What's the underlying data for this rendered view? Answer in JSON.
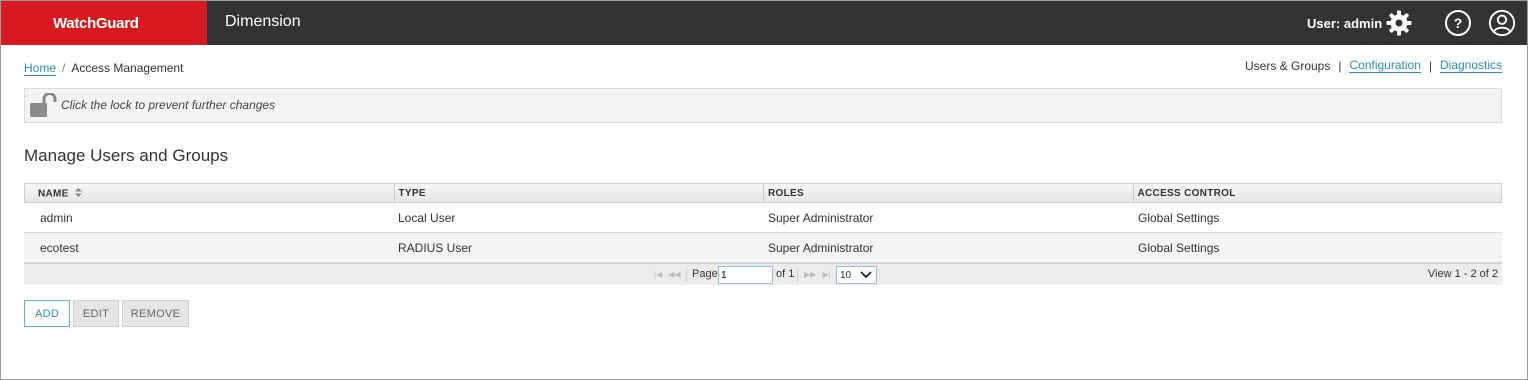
{
  "header": {
    "brand": "WatchGuard",
    "app_title": "Dimension",
    "user_label": "User: admin"
  },
  "breadcrumb": {
    "home": "Home",
    "separator": "/",
    "current": "Access Management"
  },
  "right_nav": {
    "users_groups": "Users & Groups",
    "sep": "|",
    "configuration": "Configuration",
    "diagnostics": "Diagnostics"
  },
  "lock": {
    "message": "Click the lock to prevent further changes"
  },
  "section_title": "Manage Users and Groups",
  "table": {
    "columns": [
      "NAME",
      "TYPE",
      "ROLES",
      "ACCESS CONTROL"
    ],
    "rows": [
      [
        "admin",
        "Local User",
        "Super Administrator",
        "Global Settings"
      ],
      [
        "ecotest",
        "RADIUS User",
        "Super Administrator",
        "Global Settings"
      ]
    ]
  },
  "pager": {
    "page_label": "Page",
    "page_value": "1",
    "of_label": "of 1",
    "page_size": "10",
    "view_text": "View 1 - 2 of 2"
  },
  "buttons": {
    "add": "ADD",
    "edit": "EDIT",
    "remove": "REMOVE"
  },
  "colors": {
    "brand_red": "#d71920",
    "topbar": "#333333",
    "link": "#2a8fbd"
  },
  "icons": [
    "watchguard-logo",
    "gear-icon",
    "help-icon",
    "user-icon",
    "unlock-icon",
    "sort-icon",
    "first-page-icon",
    "prev-page-icon",
    "next-page-icon",
    "last-page-icon",
    "chevron-down-icon"
  ]
}
